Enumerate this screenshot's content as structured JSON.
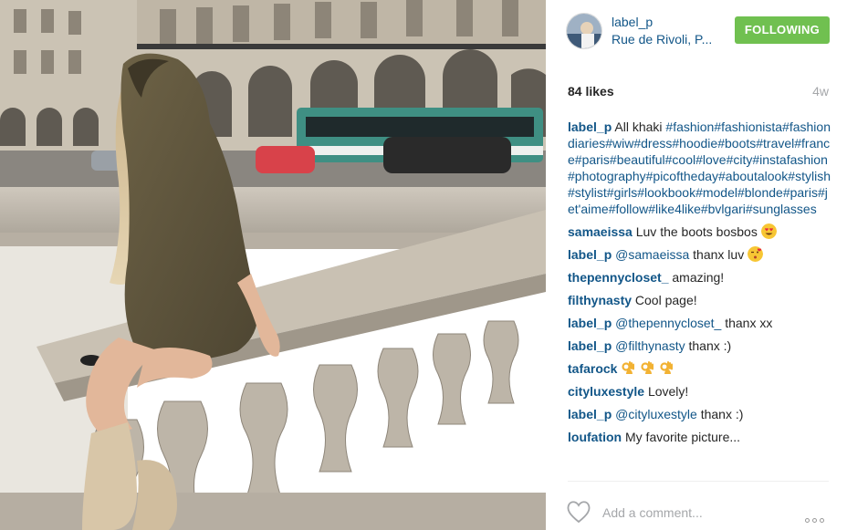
{
  "post": {
    "username": "label_p",
    "location": "Rue de Rivoli, P...",
    "follow_label": "FOLLOWING",
    "likes": "84 likes",
    "time_ago": "4w"
  },
  "caption": {
    "user": "label_p",
    "text": "All khaki",
    "hashtags": "#fashion#fashionista#fashiondiaries#wiw#dress#hoodie#boots#travel#france#paris#beautiful#cool#love#city#instafashion#photography#picoftheday#aboutalook#stylish#stylist#girls#lookbook#model#blonde#paris#jet'aime#follow#like4like#bvlgari#sunglasses"
  },
  "comments": [
    {
      "user": "samaeissa",
      "mention": "",
      "text": "Luv the boots bosbos",
      "emoji": "heart-eyes"
    },
    {
      "user": "label_p",
      "mention": "@samaeissa",
      "text": "thanx luv",
      "emoji": "kiss"
    },
    {
      "user": "thepennycloset_",
      "mention": "",
      "text": "amazing!",
      "emoji": ""
    },
    {
      "user": "filthynasty",
      "mention": "",
      "text": "Cool page!",
      "emoji": ""
    },
    {
      "user": "label_p",
      "mention": "@thepennycloset_",
      "text": "thanx xx",
      "emoji": ""
    },
    {
      "user": "label_p",
      "mention": "@filthynasty",
      "text": "thanx :)",
      "emoji": ""
    },
    {
      "user": "tafarock",
      "mention": "",
      "text": "",
      "emoji": "ok-hand-x3"
    },
    {
      "user": "cityluxestyle",
      "mention": "",
      "text": "Lovely!",
      "emoji": ""
    },
    {
      "user": "label_p",
      "mention": "@cityluxestyle",
      "text": "thanx :)",
      "emoji": ""
    },
    {
      "user": "loufation",
      "mention": "",
      "text": "My favorite picture...",
      "emoji": ""
    }
  ],
  "footer": {
    "comment_placeholder": "Add a comment...",
    "like_icon": "heart-outline-icon",
    "more_icon": "more-options-icon"
  },
  "colors": {
    "link": "#125688",
    "follow_button": "#70c050",
    "muted": "#a5a7aa"
  }
}
